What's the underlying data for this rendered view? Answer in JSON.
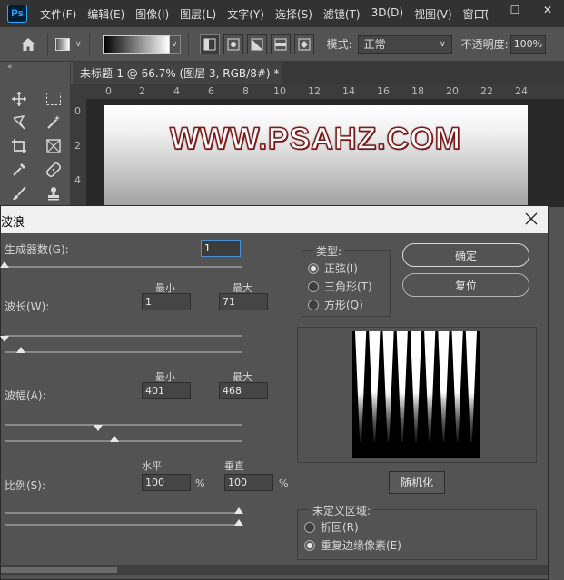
{
  "app": {
    "logo": "Ps"
  },
  "menu": [
    "文件(F)",
    "编辑(E)",
    "图像(I)",
    "图层(L)",
    "文字(Y)",
    "选择(S)",
    "滤镜(T)",
    "3D(D)",
    "视图(V)",
    "窗口("
  ],
  "window_controls": {
    "minimize": "—",
    "maximize": "☐",
    "close": "✕"
  },
  "options_bar": {
    "mode_label": "模式:",
    "mode_value": "正常",
    "opacity_label": "不透明度:",
    "opacity_value": "100%"
  },
  "toolbar": {
    "collapse": "«"
  },
  "document": {
    "tab_title": "未标题-1 @ 66.7% (图层 3, RGB/8#) *",
    "tab_close": "✕",
    "canvas_text": "WWW.PSAHZ.COM"
  },
  "ruler": {
    "h": [
      "0",
      "2",
      "4",
      "6",
      "8",
      "10",
      "12",
      "14",
      "16",
      "18",
      "20",
      "22",
      "24"
    ],
    "v": [
      "0",
      "2",
      "4"
    ]
  },
  "dialog": {
    "title": "波浪",
    "close": "✕",
    "generators": {
      "label": "生成器数(G):",
      "value": "1",
      "fraction": 0.0
    },
    "wavelength": {
      "label": "波长(W):",
      "min_label": "最小",
      "max_label": "最大",
      "min": "1",
      "max": "71",
      "min_fraction": 0.0,
      "max_fraction": 0.07
    },
    "amplitude": {
      "label": "波幅(A):",
      "min_label": "最小",
      "max_label": "最大",
      "min": "401",
      "max": "468",
      "min_fraction": 0.4,
      "max_fraction": 0.47
    },
    "scale": {
      "label": "比例(S):",
      "h_label": "水平",
      "v_label": "垂直",
      "h": "100",
      "v": "100",
      "unit": "%",
      "h_fraction": 1.0,
      "v_fraction": 1.0
    },
    "type": {
      "title": "类型:",
      "options": [
        "正弦(I)",
        "三角形(T)",
        "方形(Q)"
      ],
      "selected": 0
    },
    "buttons": {
      "ok": "确定",
      "reset": "复位",
      "randomize": "随机化"
    },
    "undefined_areas": {
      "title": "未定义区域:",
      "options": [
        "折回(R)",
        "重复边缘像素(E)"
      ],
      "selected": 1
    },
    "preview": {
      "stripes": 9
    }
  }
}
